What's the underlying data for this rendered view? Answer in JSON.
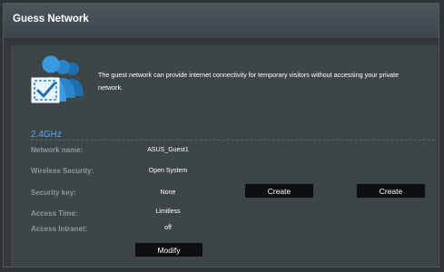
{
  "header": {
    "title": "Guess Network"
  },
  "intro": {
    "icon": "guest-users-icon",
    "text": "The guest network can provide internet connectivity for temporary visitors without accessing your private network."
  },
  "band": "2.4GHz",
  "rows": [
    {
      "label": "Network name:",
      "value": "ASUS_Guest1"
    },
    {
      "label": "Wireless Security:",
      "value": "Open System"
    },
    {
      "label": "Security key:",
      "value": "None"
    },
    {
      "label": "Access Time:",
      "value": "Limitless"
    },
    {
      "label": "Access Intranet:",
      "value": "off"
    }
  ],
  "buttons": {
    "modify": "Modify",
    "create_1": "Create",
    "create_2": "Create"
  },
  "colors": {
    "accent": "#5aa6e6",
    "panel": "#3d4549",
    "button": "#0d0f10"
  }
}
